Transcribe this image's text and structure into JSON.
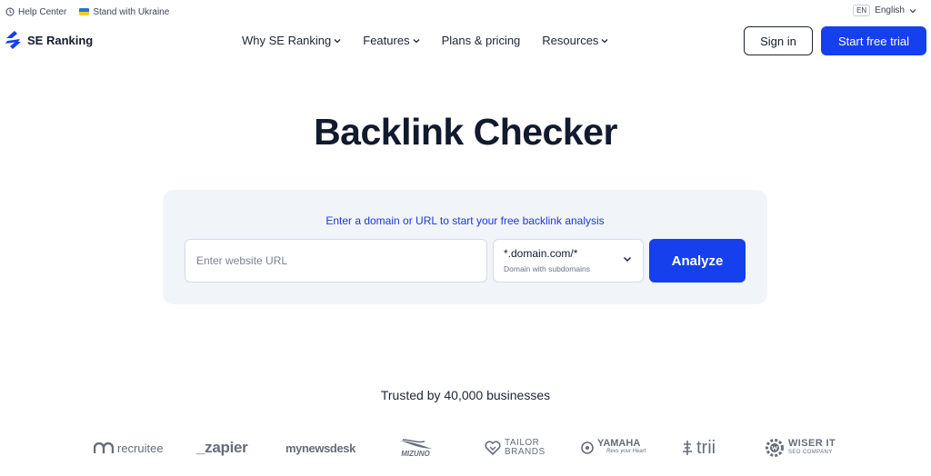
{
  "topbar": {
    "help_center": "Help Center",
    "ukraine": "Stand with Ukraine",
    "lang_code": "EN",
    "language": "English"
  },
  "nav": {
    "brand": "SE Ranking",
    "menu": [
      "Why SE Ranking",
      "Features",
      "Plans & pricing",
      "Resources"
    ],
    "sign_in": "Sign in",
    "start_trial": "Start free trial"
  },
  "hero": {
    "title": "Backlink Checker",
    "prompt": "Enter a domain or URL to start your free backlink analysis",
    "url_placeholder": "Enter website URL",
    "scope_value": "*.domain.com/*",
    "scope_desc": "Domain with subdomains",
    "analyze": "Analyze"
  },
  "trusted": {
    "heading": "Trusted by 40,000 businesses",
    "logos": {
      "recruitee": "recruitee",
      "zapier": "_zapier",
      "mynewsdesk": "mynewsdesk",
      "mizuno": "MIZUNO",
      "tailor_line1": "TAILOR",
      "tailor_line2": "BRANDS",
      "yamaha": "YAMAHA",
      "yamaha_tag": "Revs your Heart",
      "trii": "trii",
      "wiser_line1": "WISER IT",
      "wiser_line2": "SEO COMPANY"
    }
  },
  "colors": {
    "accent": "#1640ee",
    "panel": "#f1f4f9",
    "text": "#121a2e",
    "logo_gray": "#666d7a"
  }
}
